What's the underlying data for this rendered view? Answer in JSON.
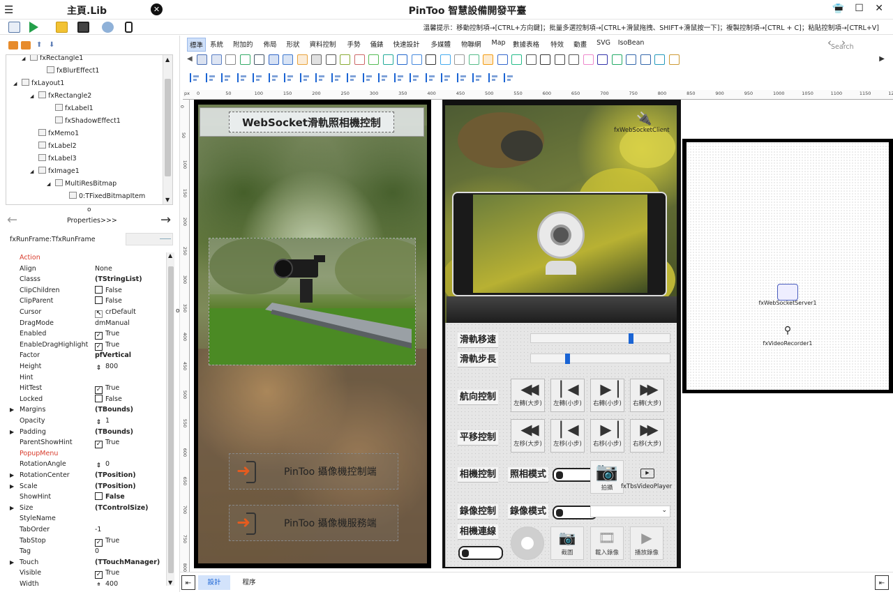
{
  "titlebar": {
    "menu_glyph": "☰",
    "lib_title": "主頁.Lib",
    "app_title": "PinToo 智慧設備開發平臺",
    "window_controls": "▬ ☐ ✕"
  },
  "hint": "溫馨提示：移動控制項→[CTRL+方向鍵]；批量多選控制項→[CTRL+滑鼠拖拽、SHIFT+滑鼠按一下]；複製控制項→[CTRL + C]；粘貼控制項→[CTRL+V]",
  "tree": {
    "nodes": [
      {
        "label": "fxRectangle1",
        "indent": 34,
        "expander": "◢"
      },
      {
        "label": "fxBlurEffect1",
        "indent": 58,
        "expander": ""
      },
      {
        "label": "fxLayout1",
        "indent": 22,
        "expander": "◢"
      },
      {
        "label": "fxRectangle2",
        "indent": 46,
        "expander": "◢"
      },
      {
        "label": "fxLabel1",
        "indent": 70,
        "expander": ""
      },
      {
        "label": "fxShadowEffect1",
        "indent": 70,
        "expander": ""
      },
      {
        "label": "fxMemo1",
        "indent": 46,
        "expander": ""
      },
      {
        "label": "fxLabel2",
        "indent": 46,
        "expander": ""
      },
      {
        "label": "fxLabel3",
        "indent": 46,
        "expander": ""
      },
      {
        "label": "fxImage1",
        "indent": 46,
        "expander": "◢"
      },
      {
        "label": "MultiResBitmap",
        "indent": 70,
        "expander": "◢"
      },
      {
        "label": "0:TFixedBitmapItem",
        "indent": 90,
        "expander": ""
      }
    ]
  },
  "prop_nav": {
    "label": "Properties>>>",
    "dot": "o"
  },
  "component_name": "fxRunFrame:TfxRunFrame",
  "properties": [
    {
      "k": "Action",
      "v": "",
      "red": true
    },
    {
      "k": "Align",
      "v": "None"
    },
    {
      "k": "Classs",
      "v": "(TStringList)",
      "bold": true
    },
    {
      "k": "ClipChildren",
      "v": "False",
      "cb": "off"
    },
    {
      "k": "ClipParent",
      "v": "False",
      "cb": "off"
    },
    {
      "k": "Cursor",
      "v": "crDefault",
      "cb": "cursor"
    },
    {
      "k": "DragMode",
      "v": "dmManual"
    },
    {
      "k": "Enabled",
      "v": "True",
      "cb": "on"
    },
    {
      "k": "EnableDragHighlight",
      "v": "True",
      "cb": "on"
    },
    {
      "k": "Factor",
      "v": "pfVertical",
      "bold": true
    },
    {
      "k": "Height",
      "v": "800",
      "cb": "num"
    },
    {
      "k": "Hint",
      "v": ""
    },
    {
      "k": "HitTest",
      "v": "True",
      "cb": "on"
    },
    {
      "k": "Locked",
      "v": "False",
      "cb": "off"
    },
    {
      "k": "Margins",
      "v": "(TBounds)",
      "bold": true,
      "exp": true
    },
    {
      "k": "Opacity",
      "v": "1",
      "cb": "num"
    },
    {
      "k": "Padding",
      "v": "(TBounds)",
      "bold": true,
      "exp": true
    },
    {
      "k": "ParentShowHint",
      "v": "True",
      "cb": "on"
    },
    {
      "k": "PopupMenu",
      "v": "",
      "red": true
    },
    {
      "k": "RotationAngle",
      "v": "0",
      "cb": "num"
    },
    {
      "k": "RotationCenter",
      "v": "(TPosition)",
      "bold": true,
      "exp": true
    },
    {
      "k": "Scale",
      "v": "(TPosition)",
      "bold": true,
      "exp": true
    },
    {
      "k": "ShowHint",
      "v": "False",
      "cb": "off",
      "bold": true
    },
    {
      "k": "Size",
      "v": "(TControlSize)",
      "bold": true,
      "exp": true
    },
    {
      "k": "StyleName",
      "v": ""
    },
    {
      "k": "TabOrder",
      "v": "-1"
    },
    {
      "k": "TabStop",
      "v": "True",
      "cb": "on"
    },
    {
      "k": "Tag",
      "v": "0"
    },
    {
      "k": "Touch",
      "v": "(TTouchManager)",
      "bold": true,
      "exp": true
    },
    {
      "k": "Visible",
      "v": "True",
      "cb": "on"
    },
    {
      "k": "Width",
      "v": "400",
      "cb": "num"
    }
  ],
  "palette_tabs": [
    "標準",
    "系統",
    "附加的",
    "佈局",
    "形狀",
    "資料控制",
    "手勢",
    "儀錶",
    "快速設計",
    "多媒體",
    "物聯網",
    "Map",
    "數據表格",
    "特效",
    "動畫",
    "SVG",
    "IsoBean"
  ],
  "search_placeholder": "Search",
  "ruler_h": [
    "px",
    "0",
    "50",
    "100",
    "150",
    "200",
    "250",
    "300",
    "350",
    "400",
    "450",
    "500",
    "550",
    "600",
    "650",
    "700",
    "750",
    "800",
    "850",
    "900",
    "950",
    "1000",
    "1050",
    "1100",
    "1150",
    "120"
  ],
  "ruler_v": [
    "0",
    "50",
    "100",
    "150",
    "200",
    "250",
    "300",
    "350",
    "400",
    "450",
    "500",
    "550",
    "600",
    "650",
    "700",
    "750",
    "800"
  ],
  "phone1": {
    "title": "WebSocket滑軌照相機控制",
    "btn_client": "PinToo 攝像機控制端",
    "btn_server": "PinToo 攝像機服務端"
  },
  "phone2": {
    "websocket_client": "fxWebSocketClient",
    "labels": {
      "speed": "滑軌移速",
      "step": "滑軌步長",
      "heading": "航向控制",
      "pan": "平移控制",
      "camera": "相機控制",
      "photo_mode": "照相模式",
      "record": "錄像控制",
      "record_mode": "錄像模式",
      "connect": "相機連線"
    },
    "speed_level": 0.72,
    "step_level": 0.25,
    "heading_buttons": [
      "左轉(大步)",
      "左轉(小步)",
      "右轉(小步)",
      "右轉(大步)"
    ],
    "pan_buttons": [
      "左移(大步)",
      "左移(小步)",
      "右移(小步)",
      "右移(大步)"
    ],
    "shoot": "拍攝",
    "video_player": "fxTbsVideoPlayer",
    "bottom_buttons": [
      "截圖",
      "載入錄像",
      "播放錄像"
    ]
  },
  "designer": {
    "server": "fxWebSocketServer1",
    "recorder": "fxVideoRecorder1"
  },
  "bottom_tabs": {
    "design": "設計",
    "code": "程序"
  },
  "accent": "#1a64d4"
}
